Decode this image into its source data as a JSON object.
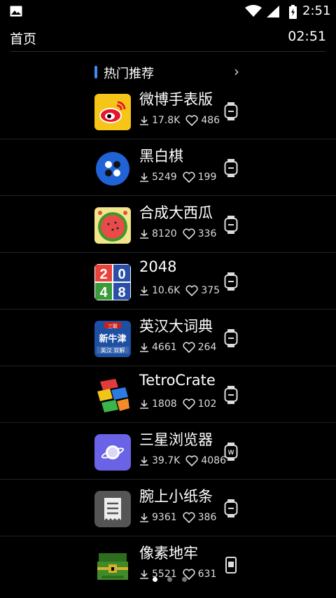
{
  "status_bar": {
    "time": "2:51",
    "icons": [
      "image-icon",
      "wifi-icon",
      "signal-icon",
      "battery-icon"
    ]
  },
  "header": {
    "title": "首页",
    "clock": "02:51"
  },
  "section": {
    "title": "热门推荐",
    "chevron": "›"
  },
  "apps": [
    {
      "name": "微博手表版",
      "downloads": "17.8K",
      "likes": "486",
      "icon": "weibo-icon",
      "device": "watch-icon"
    },
    {
      "name": "黑白棋",
      "downloads": "5249",
      "likes": "199",
      "icon": "reversi-icon",
      "device": "watch-icon"
    },
    {
      "name": "合成大西瓜",
      "downloads": "8120",
      "likes": "336",
      "icon": "watermelon-icon",
      "device": "watch-icon"
    },
    {
      "name": "2048",
      "downloads": "10.6K",
      "likes": "375",
      "icon": "game-2048-icon",
      "device": "watch-icon"
    },
    {
      "name": "英汉大词典",
      "downloads": "4661",
      "likes": "264",
      "icon": "dictionary-icon",
      "device": "watch-icon"
    },
    {
      "name": "TetroCrate",
      "downloads": "1808",
      "likes": "102",
      "icon": "tetrocrate-icon",
      "device": "watch-icon"
    },
    {
      "name": "三星浏览器",
      "downloads": "39.7K",
      "likes": "4086",
      "icon": "samsung-browser-icon",
      "device": "wear-os-icon"
    },
    {
      "name": "腕上小纸条",
      "downloads": "9361",
      "likes": "386",
      "icon": "notes-icon",
      "device": "watch-icon"
    },
    {
      "name": "像素地牢",
      "downloads": "5521",
      "likes": "631",
      "icon": "pixel-dungeon-icon",
      "device": "phone-icon"
    }
  ],
  "icon_texts": {
    "dictionary_badge": "三联",
    "dictionary_title": "新牛津",
    "dictionary_sub": "英汉 双解",
    "g2048_digits": [
      "2",
      "0",
      "4",
      "8"
    ],
    "wear_letter": "W"
  },
  "colors": {
    "accent": "#3c8ef5",
    "background": "#000000",
    "divider": "#222222"
  }
}
